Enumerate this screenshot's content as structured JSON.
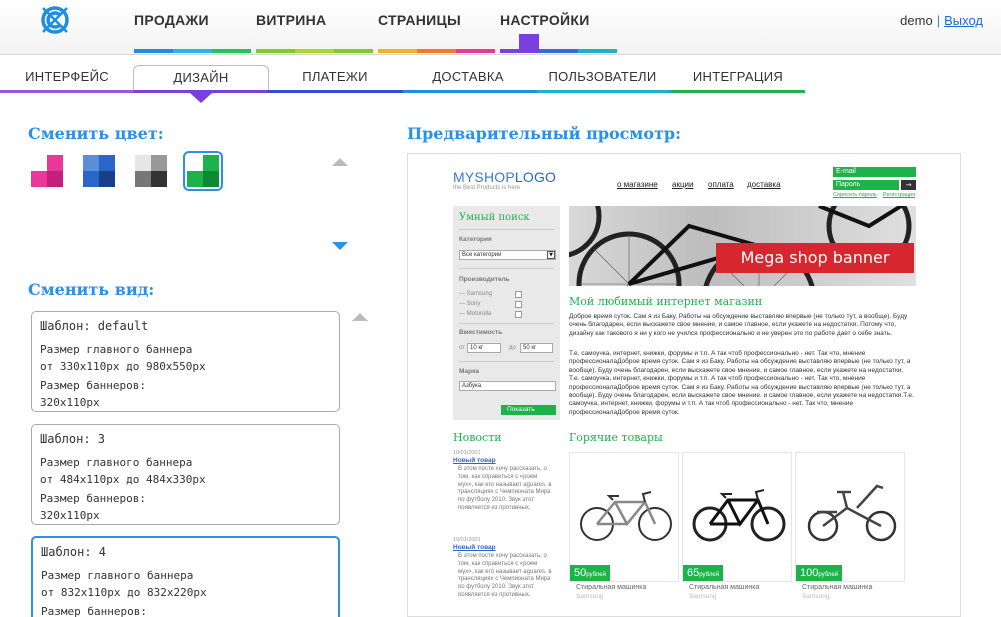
{
  "header": {
    "nav": [
      {
        "label": "ПРОДАЖИ"
      },
      {
        "label": "ВИТРИНА"
      },
      {
        "label": "СТРАНИЦЫ"
      },
      {
        "label": "НАСТРОЙКИ"
      }
    ],
    "user": "demo",
    "separator": "|",
    "logout": "Выход"
  },
  "subtabs": [
    {
      "label": "ИНТЕРФЕЙС"
    },
    {
      "label": "ДИЗАЙН"
    },
    {
      "label": "ПЛАТЕЖИ"
    },
    {
      "label": "ДОСТАВКА"
    },
    {
      "label": "ПОЛЬЗОВАТЕЛИ"
    },
    {
      "label": "ИНТЕГРАЦИЯ"
    }
  ],
  "colors": {
    "accent": "#2a90e8",
    "purple": "#7a3fe0",
    "green": "#1db34a",
    "banner_red": "#d7262d"
  },
  "design": {
    "color_title": "Сменить цвет:",
    "view_title": "Сменить вид:",
    "preview_title": "Предварительный просмотр:",
    "swatches": [
      {
        "colors": [
          "#ffffff",
          "#e8389a",
          "#e8389a",
          "#c41f7a"
        ]
      },
      {
        "colors": [
          "#5a8ed8",
          "#2a66c9",
          "#2a66c9",
          "#1a3f8a"
        ]
      },
      {
        "colors": [
          "#e6e6e6",
          "#999999",
          "#777777",
          "#333333"
        ]
      },
      {
        "colors": [
          "#ffffff",
          "#1db34a",
          "#1db34a",
          "#0e8a33"
        ],
        "selected": true
      }
    ],
    "templates": [
      {
        "name": "Шаблон: default",
        "l1": "Размер главного баннера",
        "l2": "от 330x110px до 980x550px",
        "l3": "Размер баннеров:",
        "l4": "320x110px"
      },
      {
        "name": "Шаблон: 3",
        "l1": "Размер главного баннера",
        "l2": "от 484x110px до 484x330px",
        "l3": "Размер баннеров:",
        "l4": "320x110px"
      },
      {
        "name": "Шаблон: 4",
        "l1": "Размер главного баннера",
        "l2": "от 832x110px до 832x220px",
        "l3": "Размер баннеров:"
      }
    ]
  },
  "preview": {
    "logo_a": "MYSHOP",
    "logo_b": "LOGO",
    "slogan": "the Best Products is here",
    "nav": [
      "о магазине",
      "акции",
      "оплата",
      "доставка"
    ],
    "email": "E-mail",
    "password": "Пароль",
    "go": "→",
    "forgot": "Спросить пароль",
    "register": "Регистрация",
    "search": {
      "title": "Умный поиск",
      "category_label": "Категория",
      "category_value": "Все категории",
      "maker_label": "Производитель",
      "makers": [
        "— Samsung",
        "— Sony",
        "— Motorolla"
      ],
      "capacity_label": "Вместимость",
      "from": "от",
      "from_value": "10 кг",
      "to": "до",
      "to_value": "50 кг",
      "brand_label": "Марка",
      "brand_value": "Азбука",
      "show": "Показать"
    },
    "banner": "Mega shop banner",
    "h1": "Мой любимый интернет магазин",
    "p1": "Доброе время суток. Сам я из Баку. Работы на обсуждение выставляю впервые (не только тут, а вообще). Буду очень благодарен, если выскажете свое мнение, и самое главное, если укажете на недостатки. Потому что, дизайну как такового я ни у кого не учился профессионально и не уверен это по работе дает о себе знать.",
    "p2": "Т.е. самоучка, интернет, книжки, форумы и т.п. А так чтоб профессионально - нет. Так что, мнение профессионалаДоброе время суток. Сам я из Баку. Работы на обсуждение выставляю впервые (не только тут, а вообще). Буду очень благодарен, если выскажете свое мнение, и самое главное, если укажете на недостатки. Т.е. самоучка, интернет, книжки, форумы и т.п. А так чтоб профессионально - нет. Так что, мнение профессионалаДоброе время суток. Сам я из Баку. Работы на обсуждение выставляю впервые (не только тут, а вообще). Буду очень благодарен, если выскажете свое мнение. и самое главное, если укажете на недостатки.Т.е. самоучка, интернет, книжки, форумы и т.п. А так чтоб профессионально - нет. Так что, мнение профессионалаДоброе время суток.",
    "news_title": "Новости",
    "news": [
      {
        "date": "10/01/2001",
        "title": "Новый товар",
        "body": "В этом посте хочу рассказать, о том, как справиться с «роем мух», как его называет aguares, в трансляциях с Чемпионата Мира по футболу 2010. Звук этот появляется из противных."
      },
      {
        "date": "10/01/2001",
        "title": "Новый товар",
        "body": "В этом посте хочу рассказать, о том, как справиться с «роем мух», как его называет aguares, в трансляциях с Чемпионата Мира по футболу 2010. Звук этот появляется из противных."
      }
    ],
    "hot_title": "Горячие товары",
    "products": [
      {
        "price": "50",
        "currency": "рублей",
        "name": "Стиральная машинка",
        "brand": "Samsung"
      },
      {
        "price": "65",
        "currency": "рублей",
        "name": "Стиральная машинка",
        "brand": "Samsung"
      },
      {
        "price": "100",
        "currency": "рублей",
        "name": "Стиральная машинка",
        "brand": "Samsung"
      }
    ]
  }
}
